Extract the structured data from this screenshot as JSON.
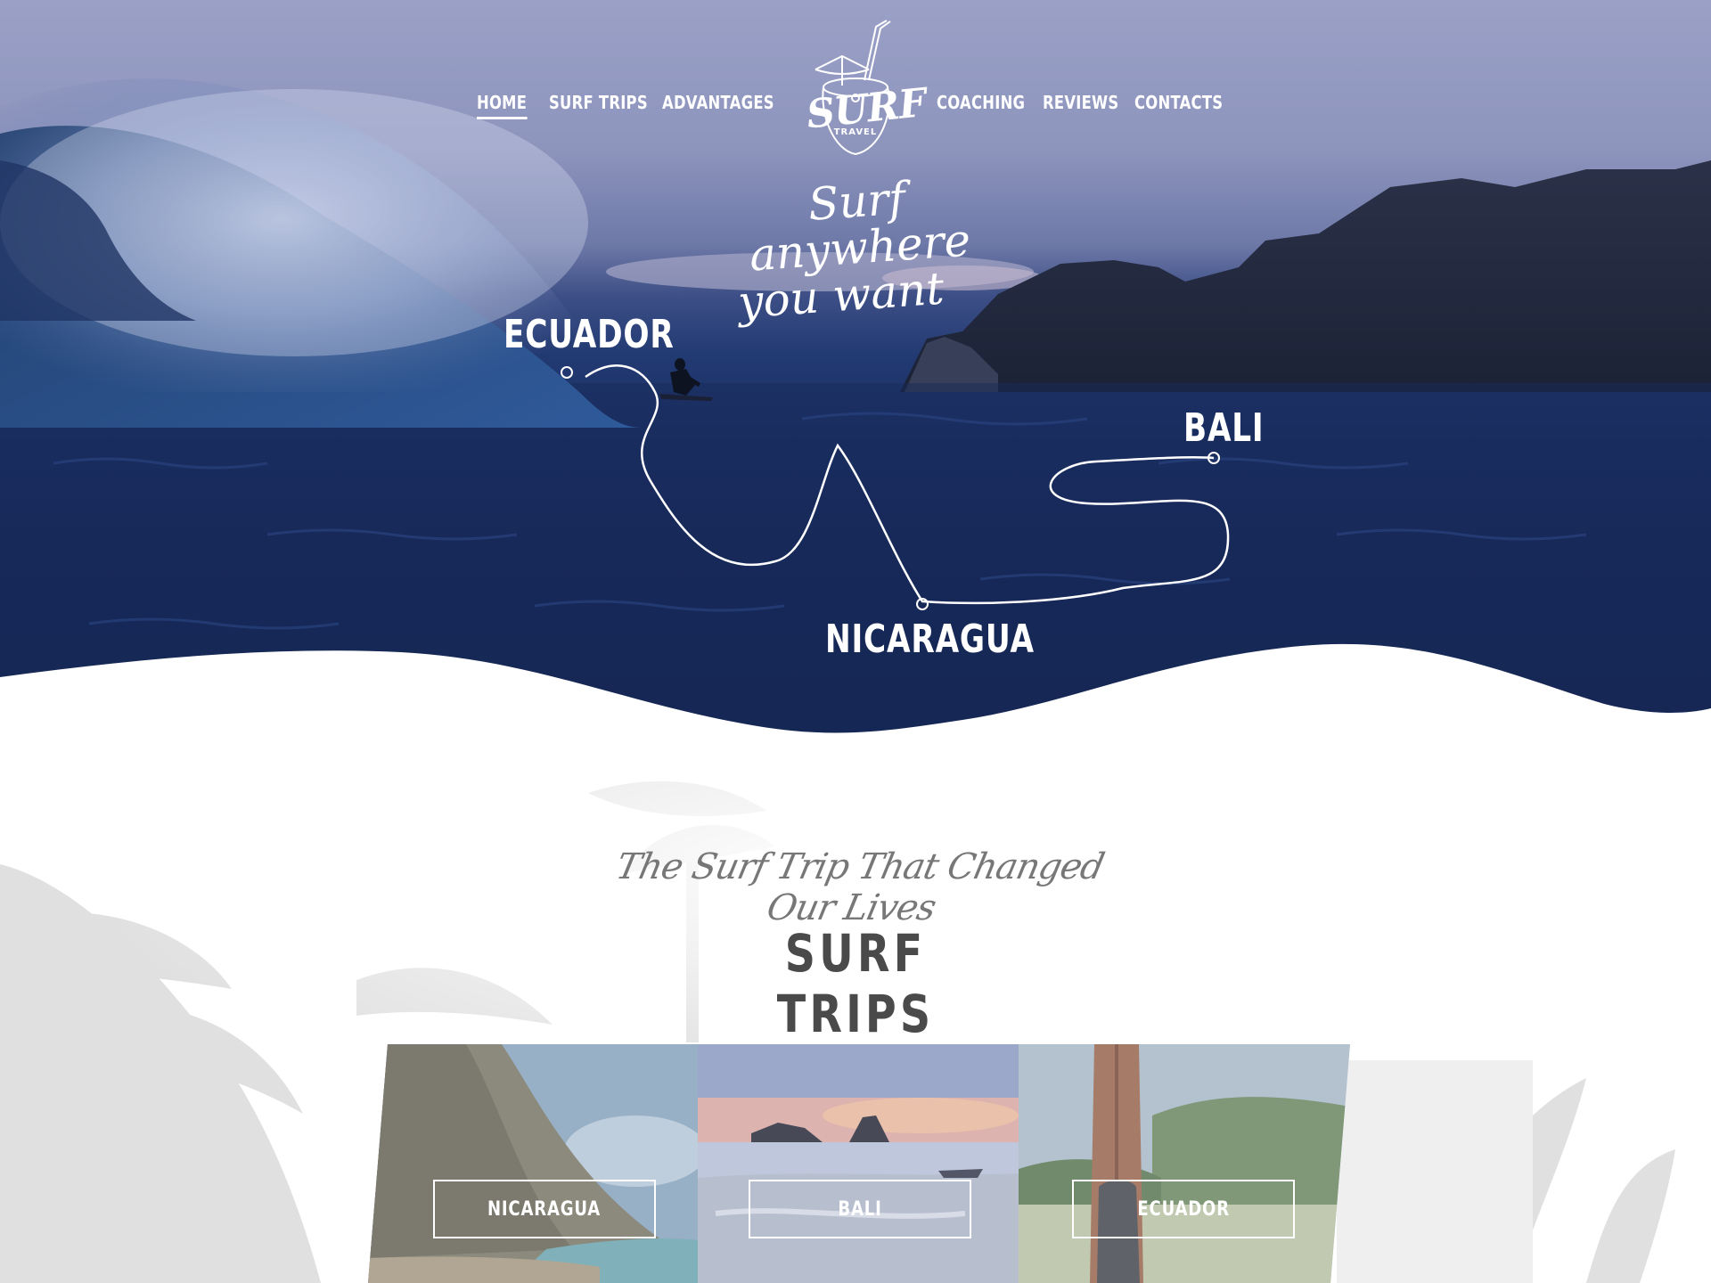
{
  "nav": {
    "items": [
      {
        "label": "HOME",
        "active": true
      },
      {
        "label": "SURF TRIPS",
        "active": false
      },
      {
        "label": "ADVANTAGES",
        "active": false
      },
      {
        "label": "COACHING",
        "active": false
      },
      {
        "label": "REVIEWS",
        "active": false
      },
      {
        "label": "CONTACTS",
        "active": false
      }
    ]
  },
  "logo": {
    "word": "SURF",
    "sub": "TRAVEL",
    "icon": "coconut-drink-icon"
  },
  "hero": {
    "tagline_line1": "Surf anywhere",
    "tagline_line2": "you want",
    "destinations": [
      "ECUADOR",
      "BALI",
      "NICARAGUA"
    ]
  },
  "trips": {
    "subtitle": "The Surf Trip That Changed Our Lives",
    "title": "SURF TRIPS",
    "cards": [
      {
        "label": "NICARAGUA"
      },
      {
        "label": "BALI"
      },
      {
        "label": "ECUADOR"
      }
    ]
  },
  "colors": {
    "ocean": "#1a2f63",
    "sky": "#9aa0c6",
    "text_dark": "#4a4a4a",
    "white": "#ffffff"
  }
}
